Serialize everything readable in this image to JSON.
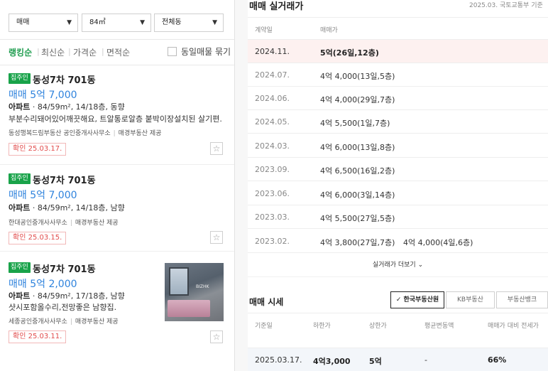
{
  "filters": {
    "trade_type": "매매",
    "area": "84㎡",
    "dong": "전체동"
  },
  "sort": {
    "items": [
      "랭킹순",
      "최신순",
      "가격순",
      "면적순"
    ],
    "same_listing_label": "동일매물 묶기"
  },
  "listings": [
    {
      "badge": "집주인",
      "title": "동성7차 701동",
      "price": "매매 5억 7,000",
      "type": "아파트",
      "spec": " · 84/59m², 14/18층, 동향",
      "desc": "부분수리돼어있어깨끗해요, 트알통로알층 붙박이장설치된 살기편...",
      "agents": [
        "동성행복드림부동산 공인중개사사무소",
        "매경부동산 제공"
      ],
      "confirm": "확인 25.03.17."
    },
    {
      "badge": "집주인",
      "title": "동성7차 701동",
      "price": "매매 5억 7,000",
      "type": "아파트",
      "spec": " · 84/59m², 14/18층, 남향",
      "agents": [
        "한대공인중개사사무소",
        "매경부동산 제공"
      ],
      "confirm": "확인 25.03.15."
    },
    {
      "badge": "집주인",
      "title": "동성7차 701동",
      "price": "매매 5억 2,000",
      "type": "아파트",
      "spec": " · 84/59m², 17/18층, 남향",
      "desc": "샷시포함올수리,전망좋은 남향집.",
      "agents": [
        "세종공인중개사사무소",
        "매경부동산 제공"
      ],
      "confirm": "확인 25.03.11.",
      "thumb_watermark": "BIZHK"
    }
  ],
  "transactions": {
    "title": "매매 실거래가",
    "source": "2025.03. 국토교통부 기준",
    "headers": {
      "date": "계약일",
      "price": "매매가"
    },
    "rows": [
      {
        "date": "2024.11.",
        "price": "5억(26일,12층)"
      },
      {
        "date": "2024.07.",
        "price": "4억 4,000(13일,5층)"
      },
      {
        "date": "2024.06.",
        "price": "4억 4,000(29일,7층)"
      },
      {
        "date": "2024.05.",
        "price": "4억 5,500(1일,7층)"
      },
      {
        "date": "2024.03.",
        "price": "4억 6,000(13일,8층)"
      },
      {
        "date": "2023.09.",
        "price": "4억 6,500(16일,2층)"
      },
      {
        "date": "2023.06.",
        "price": "4억 6,000(3일,14층)"
      },
      {
        "date": "2023.03.",
        "price": "4억 5,500(27일,5층)"
      },
      {
        "date": "2023.02.",
        "price": "4억 3,800(27일,7층)",
        "price2": "4억 4,000(4일,6층)"
      }
    ],
    "more_label": "실거래가 더보기"
  },
  "market": {
    "title": "매매 시세",
    "tabs": [
      "한국부동산원",
      "KB부동산",
      "부동산뱅크"
    ],
    "headers": [
      "기준일",
      "하한가",
      "상한가",
      "평균변동액",
      "매매가 대비 전세가"
    ],
    "row": [
      "2025.03.17.",
      "4억3,000",
      "5억",
      "-",
      "66%"
    ]
  }
}
